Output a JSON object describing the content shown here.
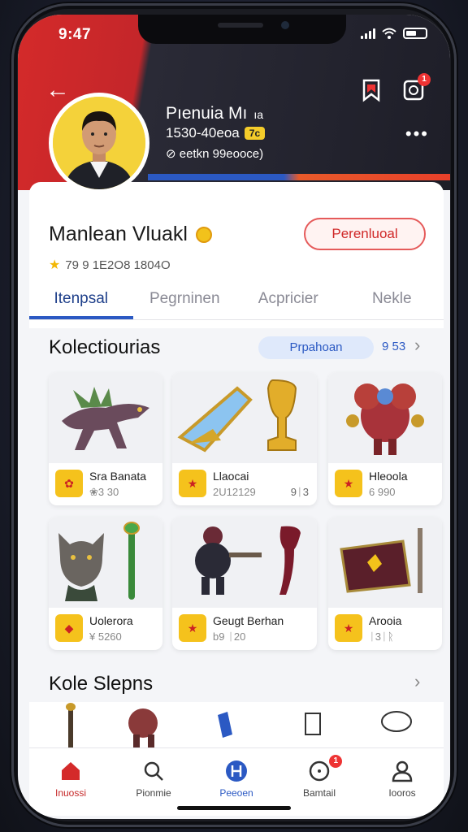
{
  "status": {
    "time": "9:47"
  },
  "profile": {
    "name": "Pıenuia Mı",
    "name_suffix": "ıa",
    "id": "1530-40eoa",
    "vip": "7c",
    "location": "⊘ eetkn 99eooce)"
  },
  "header": {
    "notification_count": "1"
  },
  "card": {
    "title": "Manlean Vluakl",
    "stats": "79  9  1E2O8 1804O",
    "follow_label": "Perenluoal"
  },
  "tabs": [
    {
      "label": "Itenpsal",
      "active": true
    },
    {
      "label": "Pegrninen",
      "active": false
    },
    {
      "label": "Acpricier",
      "active": false
    },
    {
      "label": "Nekle",
      "active": false
    }
  ],
  "collections": {
    "title": "Kolectiourias",
    "filter_label": "Prpahoan",
    "count": "9 53",
    "items": [
      {
        "name": "Sra Banata",
        "meta": "❀3 30",
        "meta2": ""
      },
      {
        "name": "Llaocai",
        "meta": "2U12129",
        "meta2": "9ᛁ3"
      },
      {
        "name": "Hleoola",
        "meta": "6 990",
        "meta2": ""
      },
      {
        "name": "Uolerora",
        "meta": "¥ 5260",
        "meta2": ""
      },
      {
        "name": "Geugt Berhan",
        "meta": "b9 ᛁ20",
        "meta2": ""
      },
      {
        "name": "Arooia",
        "meta": "ᛁ3ᛁᚱ",
        "meta2": ""
      }
    ]
  },
  "section2": {
    "title": "Kole Slepns"
  },
  "nav": [
    {
      "label": "Inuossi",
      "icon": "home-icon"
    },
    {
      "label": "Pionmie",
      "icon": "search-icon"
    },
    {
      "label": "Peeoen",
      "icon": "shield-icon"
    },
    {
      "label": "Bamtail",
      "icon": "clock-icon",
      "badge": "1"
    },
    {
      "label": "Iooros",
      "icon": "user-icon"
    }
  ],
  "colors": {
    "brand_red": "#d42a2a",
    "accent_blue": "#2b59c3",
    "gold": "#f2c21b"
  }
}
